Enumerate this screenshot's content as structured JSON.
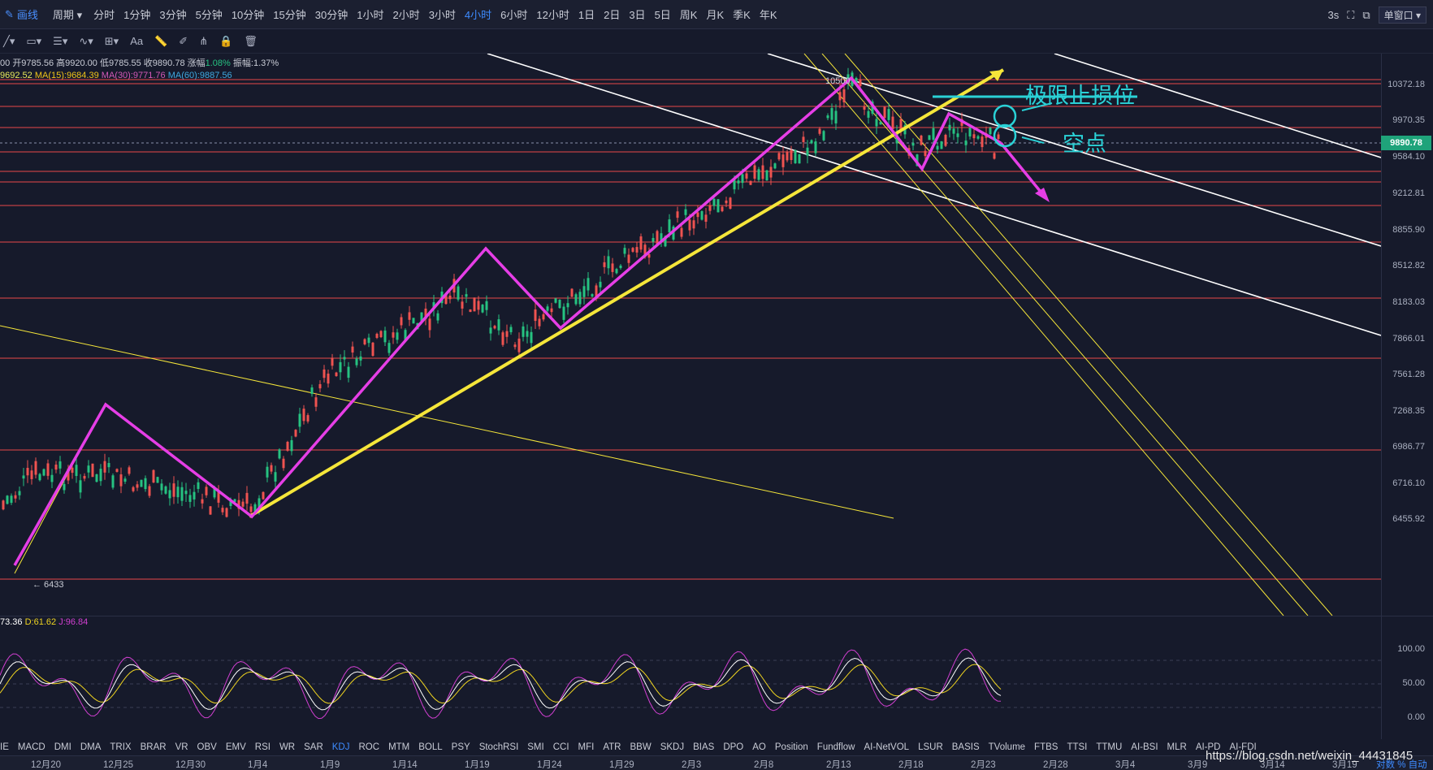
{
  "topbar": {
    "draw_label": "画线",
    "period_label": "周期",
    "periods": [
      "分时",
      "1分钟",
      "3分钟",
      "5分钟",
      "10分钟",
      "15分钟",
      "30分钟",
      "1小时",
      "2小时",
      "3小时",
      "4小时",
      "6小时",
      "12小时",
      "1日",
      "2日",
      "3日",
      "5日",
      "周K",
      "月K",
      "季K",
      "年K"
    ],
    "active_period": "4小时",
    "refresh": "3s",
    "single_window": "单窗口"
  },
  "toolbar": {
    "text_tool": "Aa"
  },
  "info": {
    "prefix": "00",
    "open": "开9785.56",
    "high": "高9920.00",
    "low": "低9785.55",
    "close": "收9890.78",
    "change_label": "涨幅",
    "change_value": "1.08%",
    "amplitude": "振幅:1.37%"
  },
  "ma": {
    "ma_prev": "9692.52",
    "ma15": "MA(15):9684.39",
    "ma30": "MA(30):9771.76",
    "ma60": "MA(60):9887.56"
  },
  "price_axis": {
    "ticks": [
      "10372.18",
      "9970.35",
      "9584.10",
      "9212.81",
      "8855.90",
      "8512.82",
      "8183.03",
      "7866.01",
      "7561.28",
      "7268.35",
      "6986.77",
      "6716.10",
      "6455.92"
    ],
    "current_price": "9890.78"
  },
  "chart_labels": {
    "low_marker": "← 6433",
    "high_marker": "10500",
    "stop_loss": "极限止损位",
    "short_point": "空点"
  },
  "kdj": {
    "k": "73.36",
    "d": "D:61.62",
    "j": "J:96.84",
    "ticks": [
      "100.00",
      "50.00",
      "0.00"
    ]
  },
  "indicators": [
    "IE",
    "MACD",
    "DMI",
    "DMA",
    "TRIX",
    "BRAR",
    "VR",
    "OBV",
    "EMV",
    "RSI",
    "WR",
    "SAR",
    "KDJ",
    "ROC",
    "MTM",
    "BOLL",
    "PSY",
    "StochRSI",
    "SMI",
    "CCI",
    "MFI",
    "ATR",
    "BBW",
    "SKDJ",
    "BIAS",
    "DPO",
    "AO",
    "Position",
    "Fundflow",
    "AI-NetVOL",
    "LSUR",
    "BASIS",
    "TVolume",
    "FTBS",
    "TTSI",
    "TTMU",
    "AI-BSI",
    "MLR",
    "AI-PD",
    "AI-FDI"
  ],
  "active_indicator": "KDJ",
  "dates": [
    "12月20",
    "12月25",
    "12月30",
    "1月4",
    "1月9",
    "1月14",
    "1月19",
    "1月24",
    "1月29",
    "2月3",
    "2月8",
    "2月13",
    "2月18",
    "2月23",
    "2月28",
    "3月4",
    "3月9",
    "3月14",
    "3月19"
  ],
  "datebar_right": [
    "对数",
    "%",
    "自动"
  ],
  "watermark": "https://blog.csdn.net/weixin_44431845",
  "colors": {
    "background": "#161a2b",
    "support_line": "#ff4d4d",
    "trend_yellow": "#f5e63a",
    "zigzag_magenta": "#e63ee6",
    "annotation_cyan": "#2ad1d6",
    "price_tag": "#1fa37a",
    "active_blue": "#3d8bff"
  }
}
